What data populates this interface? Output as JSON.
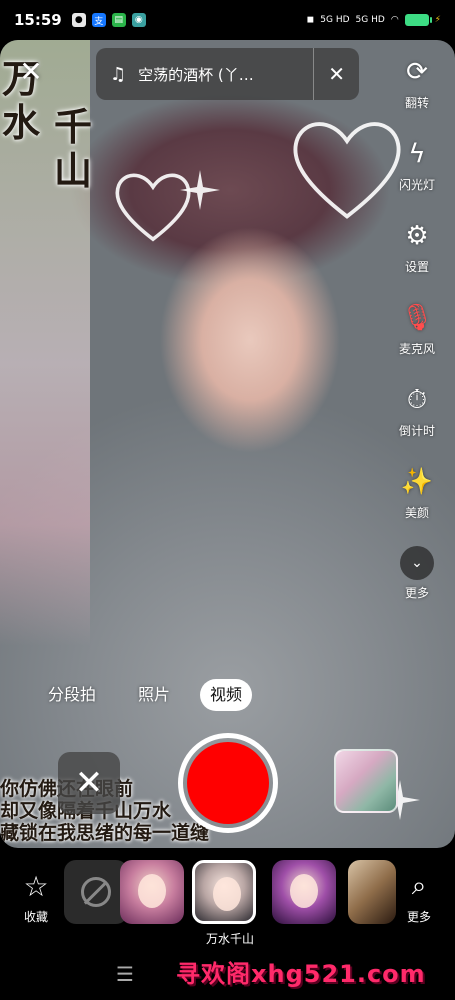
{
  "status_bar": {
    "time": "15:59",
    "network_1": "5G HD",
    "network_2": "5G HD",
    "battery_color": "#3ddc84"
  },
  "preview": {
    "deco_text_1": "万",
    "deco_text_2": "水",
    "deco_text_3": "千",
    "deco_text_4": "山",
    "lyrics": [
      "你仿佛还在眼前",
      "却又像隔着千山万水",
      "藏锁在我思绪的每一道缝"
    ]
  },
  "music": {
    "icon": "music-note-icon",
    "title": "空荡的酒杯 (丫…"
  },
  "tools": [
    {
      "icon": "flip-camera-icon",
      "label": "翻转"
    },
    {
      "icon": "flash-off-icon",
      "label": "闪光灯"
    },
    {
      "icon": "settings-gear-icon",
      "label": "设置"
    },
    {
      "icon": "microphone-off-icon",
      "label": "麦克风"
    },
    {
      "icon": "timer-icon",
      "label": "倒计时"
    },
    {
      "icon": "beauty-wand-icon",
      "label": "美颜"
    },
    {
      "icon": "chevron-down-icon",
      "label": "更多"
    }
  ],
  "modes": [
    {
      "label": "分段拍",
      "active": false
    },
    {
      "label": "照片",
      "active": false
    },
    {
      "label": "视频",
      "active": true
    }
  ],
  "record": {
    "button_color": "#ff0000"
  },
  "effects": {
    "favorites_label": "收藏",
    "more_label": "更多",
    "selected_caption": "万水千山"
  },
  "watermark": "寻欢阁xhg521.com"
}
